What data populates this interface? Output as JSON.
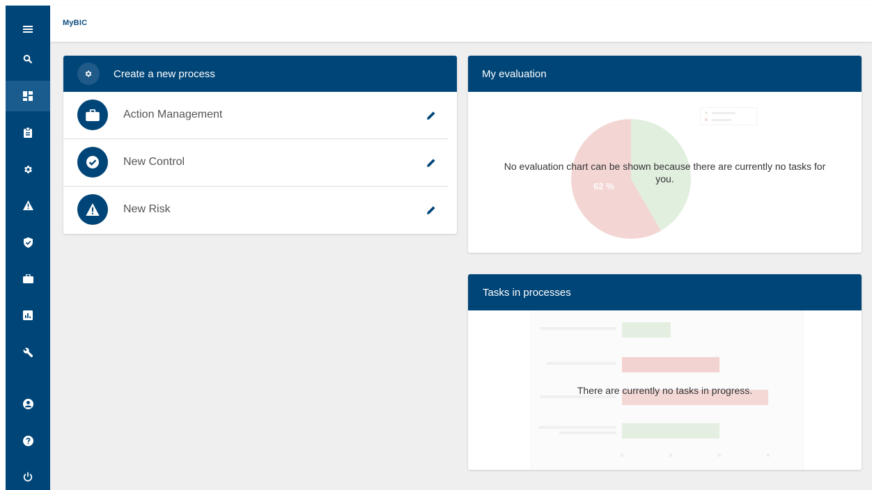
{
  "app": {
    "title": "MyBIC"
  },
  "sidebar": {
    "items": [
      {
        "name": "menu-icon",
        "active": false
      },
      {
        "name": "search-icon",
        "active": false
      },
      {
        "name": "dashboard-icon",
        "active": true
      },
      {
        "name": "clipboard-icon",
        "active": false
      },
      {
        "name": "gear-icon",
        "active": false
      },
      {
        "name": "warning-icon",
        "active": false
      },
      {
        "name": "shield-icon",
        "active": false
      },
      {
        "name": "briefcase-icon",
        "active": false
      },
      {
        "name": "chart-icon",
        "active": false
      },
      {
        "name": "wrench-icon",
        "active": false
      },
      {
        "name": "account-icon",
        "active": false
      },
      {
        "name": "help-icon",
        "active": false
      },
      {
        "name": "power-icon",
        "active": false
      }
    ]
  },
  "create_process": {
    "title": "Create a new process",
    "icon": "gear-icon",
    "items": [
      {
        "label": "Action Management",
        "icon": "briefcase-icon"
      },
      {
        "label": "New Control",
        "icon": "check-circle-icon"
      },
      {
        "label": "New Risk",
        "icon": "warning-icon"
      }
    ]
  },
  "evaluation": {
    "title": "My evaluation",
    "message": "No evaluation chart can be shown because there are currently no tasks for you.",
    "pie_label": "62 %"
  },
  "tasks": {
    "title": "Tasks in processes",
    "message": "There are currently no tasks in progress."
  },
  "colors": {
    "primary": "#004578",
    "sidebar_active": "#1a5c8e",
    "background": "#efefef",
    "pie_green": "#dcecd8",
    "pie_red": "#f1cfcd"
  }
}
